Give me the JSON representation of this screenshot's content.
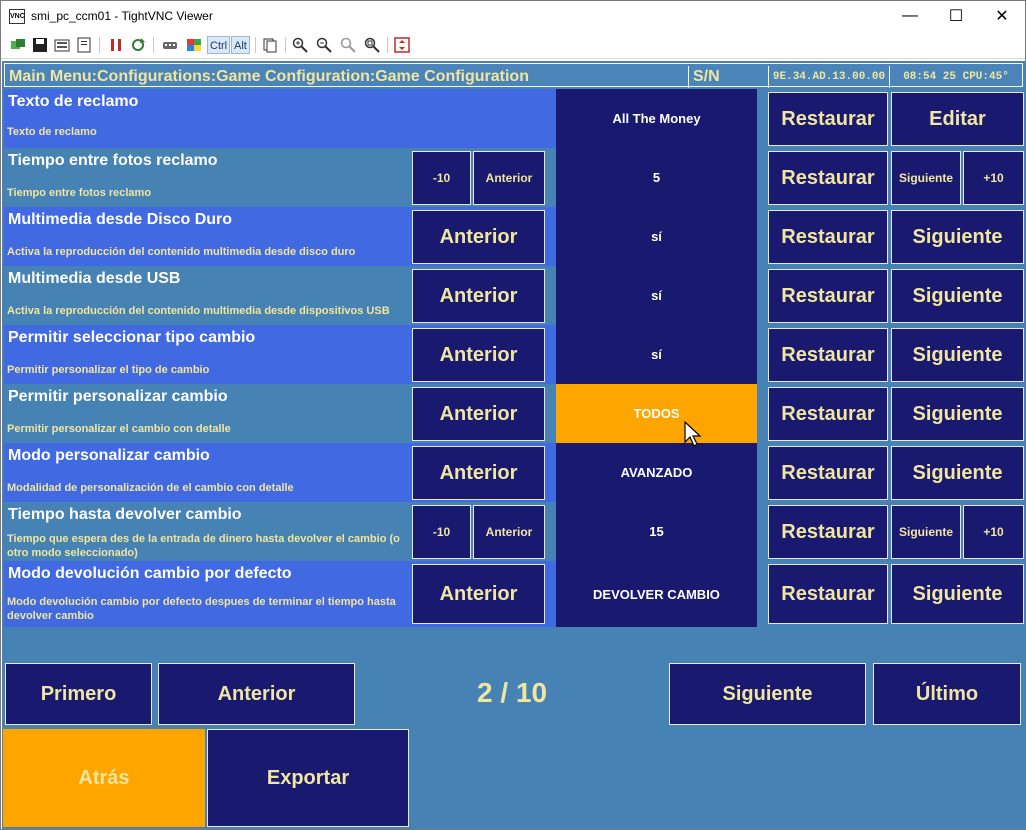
{
  "window": {
    "title": "smi_pc_ccm01 - TightVNC Viewer",
    "app_icon_text": "VNC",
    "controls": {
      "minimize": "—",
      "maximize": "☐",
      "close": "✕"
    }
  },
  "toolbar": {
    "ctrl_label": "Ctrl",
    "alt_label": "Alt"
  },
  "header": {
    "breadcrumb": "Main Menu:Configurations:Game Configuration:Game Configuration",
    "sn_label": "S/N",
    "sn_value": "9E.34.AD.13.00.00",
    "status": "08:54 25 CPU:45°"
  },
  "settings": [
    {
      "title": "Texto de reclamo",
      "desc": "Texto de reclamo",
      "value": "All The Money",
      "left": "",
      "right": "Editar",
      "restore": "Restaurar"
    },
    {
      "title": "Tiempo entre fotos reclamo",
      "desc": "Tiempo entre fotos reclamo",
      "value": "5",
      "minus": "-10",
      "left": "Anterior",
      "right": "Siguiente",
      "plus": "+10",
      "restore": "Restaurar"
    },
    {
      "title": "Multimedia desde Disco Duro",
      "desc": "Activa la reproducción del contenido multimedia desde disco duro",
      "value": "sí",
      "left": "Anterior",
      "right": "Siguiente",
      "restore": "Restaurar"
    },
    {
      "title": "Multimedia desde USB",
      "desc": "Activa la reproducción del contenido multimedia desde dispositivos USB",
      "value": "sí",
      "left": "Anterior",
      "right": "Siguiente",
      "restore": "Restaurar"
    },
    {
      "title": "Permitir seleccionar tipo cambio",
      "desc": "Permitir personalizar el tipo de cambio",
      "value": "sí",
      "left": "Anterior",
      "right": "Siguiente",
      "restore": "Restaurar"
    },
    {
      "title": "Permitir personalizar cambio",
      "desc": "Permitir personalizar el cambio con detalle",
      "value": "TODOS",
      "left": "Anterior",
      "right": "Siguiente",
      "restore": "Restaurar"
    },
    {
      "title": "Modo personalizar cambio",
      "desc": "Modalidad de personalización de el cambio con detalle",
      "value": "AVANZADO",
      "left": "Anterior",
      "right": "Siguiente",
      "restore": "Restaurar"
    },
    {
      "title": "Tiempo hasta devolver cambio",
      "desc": "Tiempo que espera des de la entrada de dinero hasta devolver el cambio (o otro modo seleccionado)",
      "value": "15",
      "minus": "-10",
      "left": "Anterior",
      "right": "Siguiente",
      "plus": "+10",
      "restore": "Restaurar"
    },
    {
      "title": "Modo devolución cambio por defecto",
      "desc": "Modo devolución cambio por defecto despues de terminar el tiempo hasta devolver cambio",
      "value": "DEVOLVER CAMBIO",
      "left": "Anterior",
      "right": "Siguiente",
      "restore": "Restaurar"
    }
  ],
  "pagination": {
    "first": "Primero",
    "prev": "Anterior",
    "indicator": "2 / 10",
    "next": "Siguiente",
    "last": "Último"
  },
  "footer": {
    "back": "Atrás",
    "export": "Exportar"
  },
  "colors": {
    "navy": "#191970",
    "steel": "#4682b4",
    "royal": "#4169e1",
    "orange": "#ffa500",
    "gold_text": "#f0e6a0"
  }
}
